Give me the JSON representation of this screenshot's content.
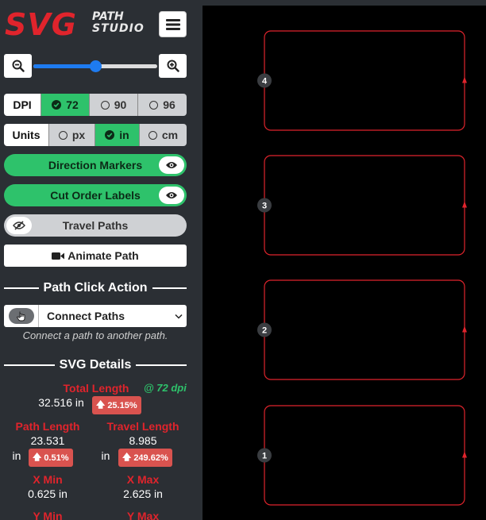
{
  "logo": {
    "main": "SVG",
    "line1": "PATH",
    "line2": "STUDIO"
  },
  "zoom": {
    "level": 0.5
  },
  "dpi": {
    "label": "DPI",
    "options": [
      "72",
      "90",
      "96"
    ],
    "selected": "72"
  },
  "units": {
    "label": "Units",
    "options": [
      "px",
      "in",
      "cm"
    ],
    "selected": "in"
  },
  "toggles": {
    "direction_markers": "Direction Markers",
    "cut_order_labels": "Cut Order Labels",
    "travel_paths": "Travel Paths"
  },
  "animate_label": "Animate Path",
  "path_click": {
    "heading": "Path Click Action",
    "selected": "Connect Paths",
    "hint": "Connect a path to another path."
  },
  "details": {
    "heading": "SVG Details",
    "total_length_label": "Total Length",
    "dpi_note": "@ 72 dpi",
    "total_length_value": "32.516 in",
    "total_length_change": "25.15%",
    "path_length_label": "Path Length",
    "path_length_value": "23.531",
    "path_length_unit": "in",
    "path_length_change": "0.51%",
    "travel_length_label": "Travel Length",
    "travel_length_value": "8.985",
    "travel_length_unit": "in",
    "travel_length_change": "249.62%",
    "x_min_label": "X Min",
    "x_min_value": "0.625 in",
    "x_max_label": "X Max",
    "x_max_value": "2.625 in",
    "y_min_label": "Y Min",
    "y_max_label": "Y Max"
  },
  "paths": [
    {
      "order": "4"
    },
    {
      "order": "3"
    },
    {
      "order": "2"
    },
    {
      "order": "1"
    }
  ],
  "colors": {
    "accent_red": "#e0242c",
    "active_green": "#2ec26b",
    "slider_blue": "#1e7bf0",
    "badge_red": "#d9534f"
  }
}
